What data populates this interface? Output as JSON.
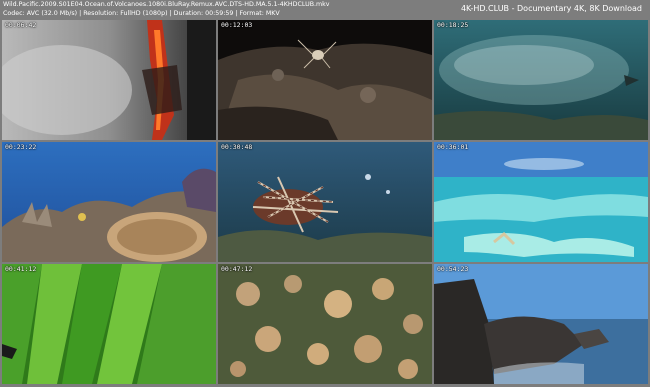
{
  "header": {
    "filename": "Wild.Pacific.2009.S01E04.Ocean.of.Volcanoes.1080i.BluRay.Remux.AVC.DTS-HD.MA.5.1-4KHDCLUB.mkv",
    "info": "Codec: AVC (32.0 Mb/s)  |  Resolution: FullHD (1080p)  |  Duration: 00:59:59  |  Format: MKV",
    "brand": "4K-HD.CLUB - Documentary 4K, 8K Download"
  },
  "thumbnails": [
    {
      "timestamp": "00:06:42",
      "icon": "lava-waterfall-scene"
    },
    {
      "timestamp": "00:12:03",
      "icon": "crab-on-rock-scene"
    },
    {
      "timestamp": "00:18:25",
      "icon": "fish-school-scene"
    },
    {
      "timestamp": "00:23:22",
      "icon": "coral-reef-scene"
    },
    {
      "timestamp": "00:30:48",
      "icon": "lionfish-scene"
    },
    {
      "timestamp": "00:36:01",
      "icon": "lagoon-aerial-scene"
    },
    {
      "timestamp": "00:41:12",
      "icon": "palm-frond-scene"
    },
    {
      "timestamp": "00:47:12",
      "icon": "jellyfish-scene"
    },
    {
      "timestamp": "00:54:23",
      "icon": "rocky-coast-scene"
    }
  ]
}
